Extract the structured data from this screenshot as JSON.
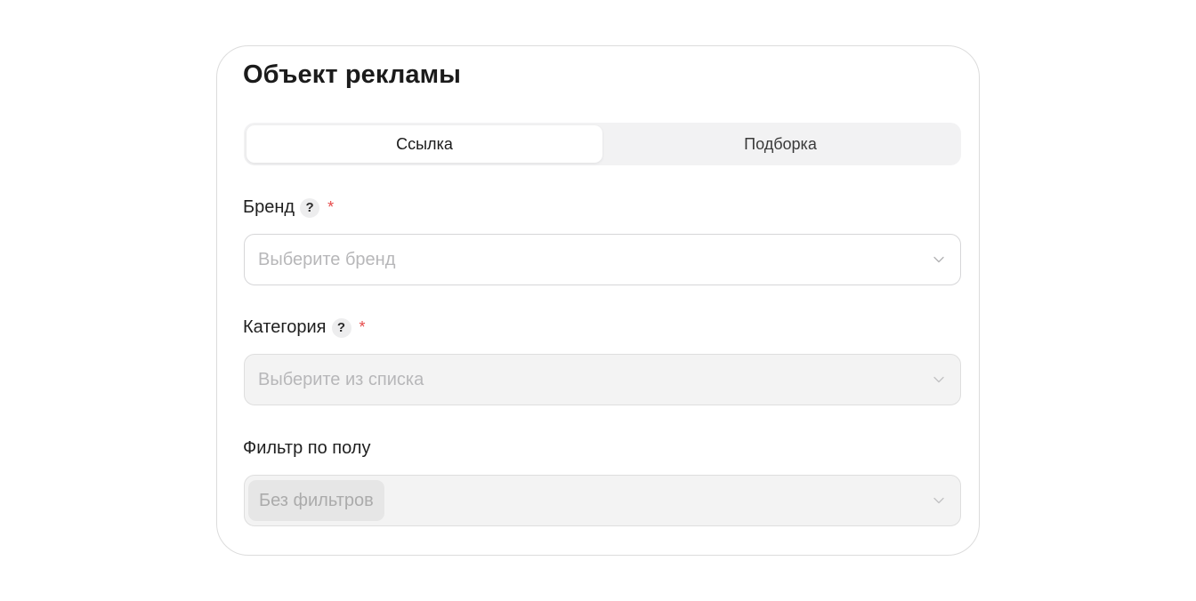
{
  "card": {
    "title": "Объект рекламы"
  },
  "tabs": [
    {
      "label": "Ссылка",
      "active": true
    },
    {
      "label": "Подборка",
      "active": false
    }
  ],
  "fields": {
    "brand": {
      "label": "Бренд",
      "help": "?",
      "required": "*",
      "placeholder": "Выберите бренд",
      "disabled": false
    },
    "category": {
      "label": "Категория",
      "help": "?",
      "required": "*",
      "placeholder": "Выберите из списка",
      "disabled": true
    },
    "gender_filter": {
      "label": "Фильтр по полу",
      "selected_chip": "Без фильтров",
      "disabled": true
    }
  },
  "icons": {
    "chevron": "chevron-down-icon",
    "help": "question-icon"
  },
  "colors": {
    "required": "#e64a4a",
    "border": "#d6d6d8",
    "disabled_bg": "#f3f3f3",
    "placeholder": "#b7b7b9"
  }
}
